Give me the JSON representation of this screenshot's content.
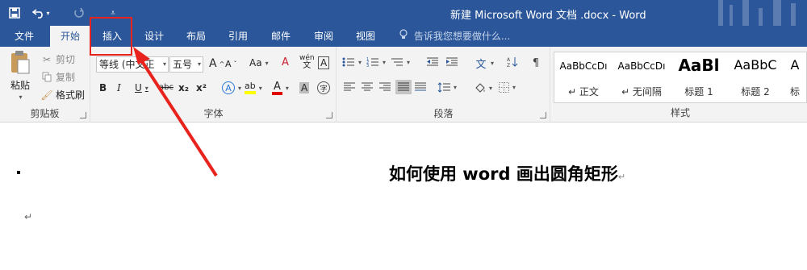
{
  "window": {
    "title": "新建 Microsoft Word 文档 .docx - Word"
  },
  "quick_access": {
    "save_icon": "save-icon",
    "undo_icon": "undo-icon",
    "redo_icon": "redo-icon",
    "customize_icon": "customize-qat-icon"
  },
  "tabs": [
    {
      "label": "文件"
    },
    {
      "label": "开始"
    },
    {
      "label": "插入"
    },
    {
      "label": "设计"
    },
    {
      "label": "布局"
    },
    {
      "label": "引用"
    },
    {
      "label": "邮件"
    },
    {
      "label": "审阅"
    },
    {
      "label": "视图"
    }
  ],
  "tell_me": "告诉我您想要做什么...",
  "clipboard": {
    "paste": "粘贴",
    "cut": "剪切",
    "copy": "复制",
    "format_painter": "格式刷",
    "group_label": "剪贴板"
  },
  "font": {
    "family": "等线 (中文正",
    "size": "五号",
    "grow": "A",
    "shrink": "A",
    "case": "Aa",
    "clear": "A",
    "phonetic": "wén",
    "border_char": "A",
    "bold": "B",
    "italic": "I",
    "underline": "U",
    "strike": "abc",
    "subscript": "x₂",
    "superscript": "x²",
    "text_effects": "A",
    "highlight": "ab",
    "font_color": "A",
    "char_shading": "A",
    "enclose": "字",
    "group_label": "字体"
  },
  "paragraph": {
    "group_label": "段落"
  },
  "styles": {
    "items": [
      {
        "sample": "AaBbCcDı",
        "name": "↵ 正文"
      },
      {
        "sample": "AaBbCcDı",
        "name": "↵ 无间隔"
      },
      {
        "sample": "AaBl",
        "name": "标题 1"
      },
      {
        "sample": "AaBbC",
        "name": "标题 2"
      },
      {
        "sample": "A",
        "name": "标"
      }
    ],
    "group_label": "样式"
  },
  "document": {
    "heading": "如何使用 word 画出圆角矩形",
    "para_mark": "↵",
    "cursor_mark": "↵"
  },
  "colors": {
    "accent": "#2b579a",
    "annotation": "#e8231e",
    "highlight_yellow": "#ffff00",
    "font_red": "#e00000"
  }
}
